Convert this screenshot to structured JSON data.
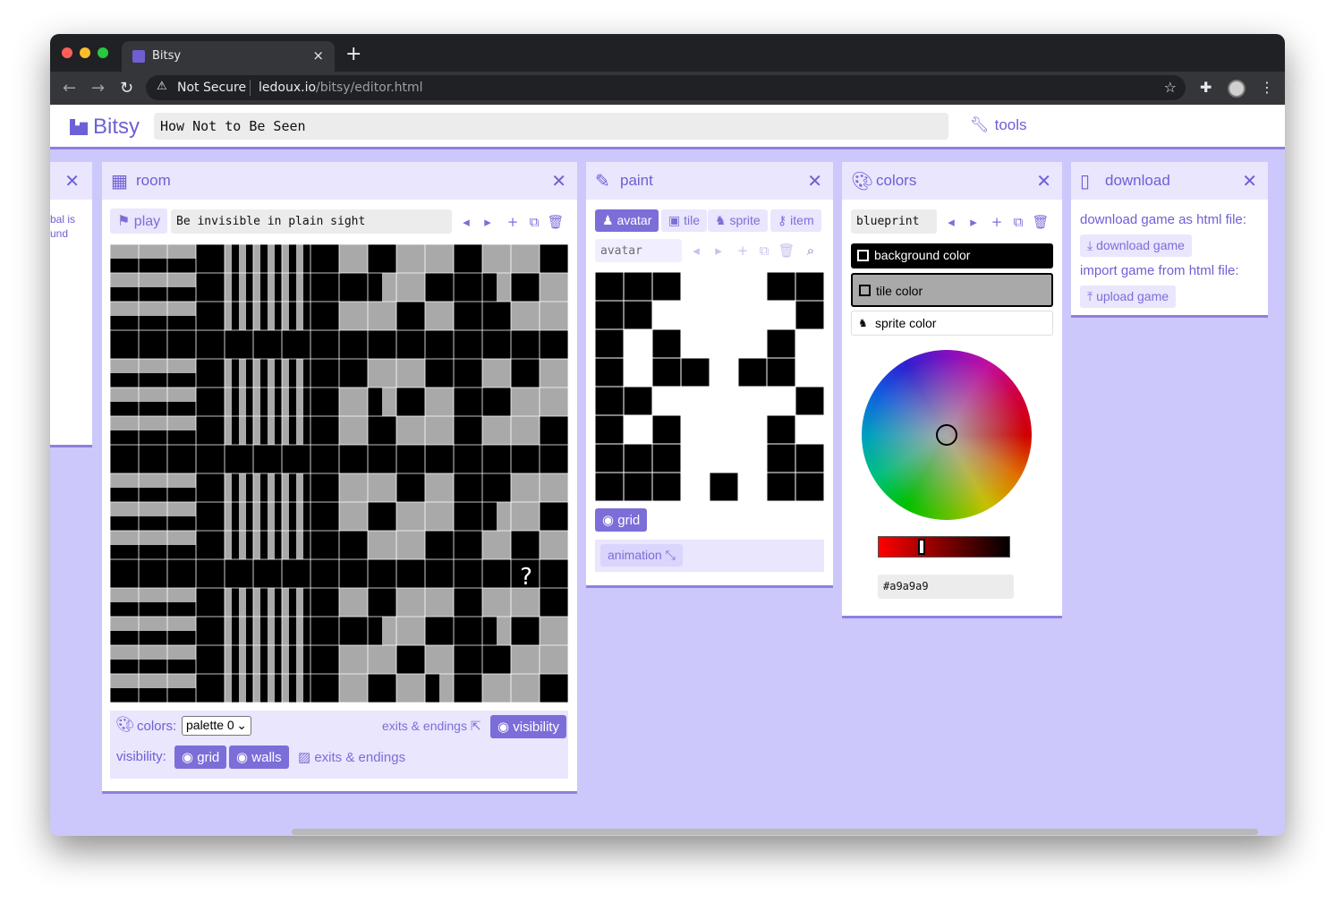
{
  "browser": {
    "tab_title": "Bitsy",
    "tab_close": "×",
    "new_tab": "+",
    "security_label": "Not Secure",
    "url_domain": "ledoux.io",
    "url_path": "/bitsy/editor.html"
  },
  "app": {
    "logo_text": "Bitsy",
    "game_title": "How Not to Be Seen",
    "tools_label": "tools"
  },
  "left_stub": {
    "text_line1": "bal is",
    "text_line2": "und"
  },
  "room": {
    "title": "room",
    "play_label": "play",
    "room_name": "Be invisible in plain sight",
    "colors_label": "colors:",
    "palette_selected": "palette 0",
    "exits_button": "exits & endings",
    "visibility_button": "visibility",
    "visibility_label": "visibility:",
    "vis_grid": "grid",
    "vis_walls": "walls",
    "vis_exits": "exits & endings",
    "grid_colors": {
      "dark": "#000000",
      "light": "#a9a9a9"
    }
  },
  "paint": {
    "title": "paint",
    "tabs": [
      "avatar",
      "tile",
      "sprite",
      "item"
    ],
    "active_tab": "avatar",
    "sprite_name": "avatar",
    "grid_toggle": "grid",
    "animation_label": "animation"
  },
  "colors": {
    "title": "colors",
    "palette_name": "blueprint",
    "background_color_label": "background color",
    "tile_color_label": "tile color",
    "sprite_color_label": "sprite color",
    "hex_value": "#a9a9a9",
    "background_color": "#000000",
    "tile_color": "#a9a9a9",
    "sprite_color": "#ffffff"
  },
  "download": {
    "title": "download",
    "download_text": "download game as html file:",
    "download_button": "download game",
    "import_text": "import game from html file:",
    "upload_button": "upload game"
  },
  "theme": {
    "accent": "#6d60d6",
    "panel_header": "#e9e6fd",
    "workspace": "#ccc8fb"
  }
}
